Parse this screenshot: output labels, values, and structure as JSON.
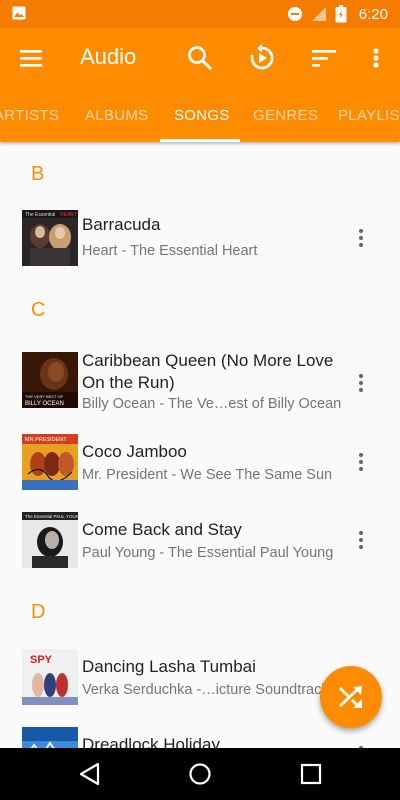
{
  "status_bar": {
    "time": "6:20",
    "icons": [
      "image-icon",
      "dnd-icon",
      "signal-icon",
      "battery-icon"
    ],
    "background": "#f57c00"
  },
  "toolbar": {
    "title": "Audio",
    "icons": [
      "menu-icon",
      "search-icon",
      "resume-icon",
      "sort-icon",
      "more-vert-icon"
    ],
    "background": "#ff8c00"
  },
  "tabs": [
    "ARTISTS",
    "ALBUMS",
    "SONGS",
    "GENRES",
    "PLAYLISTS"
  ],
  "active_tab": "SONGS",
  "sections": [
    {
      "letter": "B",
      "songs": [
        {
          "title": "Barracuda",
          "subtitle": "Heart - The Essential Heart"
        }
      ]
    },
    {
      "letter": "C",
      "songs": [
        {
          "title": "Caribbean Queen (No More Love On the Run)",
          "subtitle": "Billy Ocean - The Ve…est of Billy Ocean"
        },
        {
          "title": "Coco Jamboo",
          "subtitle": "Mr. President - We See The Same Sun"
        },
        {
          "title": "Come Back and Stay",
          "subtitle": "Paul Young - The Essential Paul Young"
        }
      ]
    },
    {
      "letter": "D",
      "songs": [
        {
          "title": "Dancing Lasha Tumbai",
          "subtitle": "Verka Serduchka -…icture Soundtrack"
        },
        {
          "title": "Dreadlock Holiday",
          "subtitle": ""
        }
      ]
    }
  ],
  "fab": {
    "icon": "shuffle-icon",
    "color": "#ff8c00"
  },
  "navbar": {
    "icons": [
      "back-icon",
      "home-icon",
      "recents-icon"
    ]
  }
}
